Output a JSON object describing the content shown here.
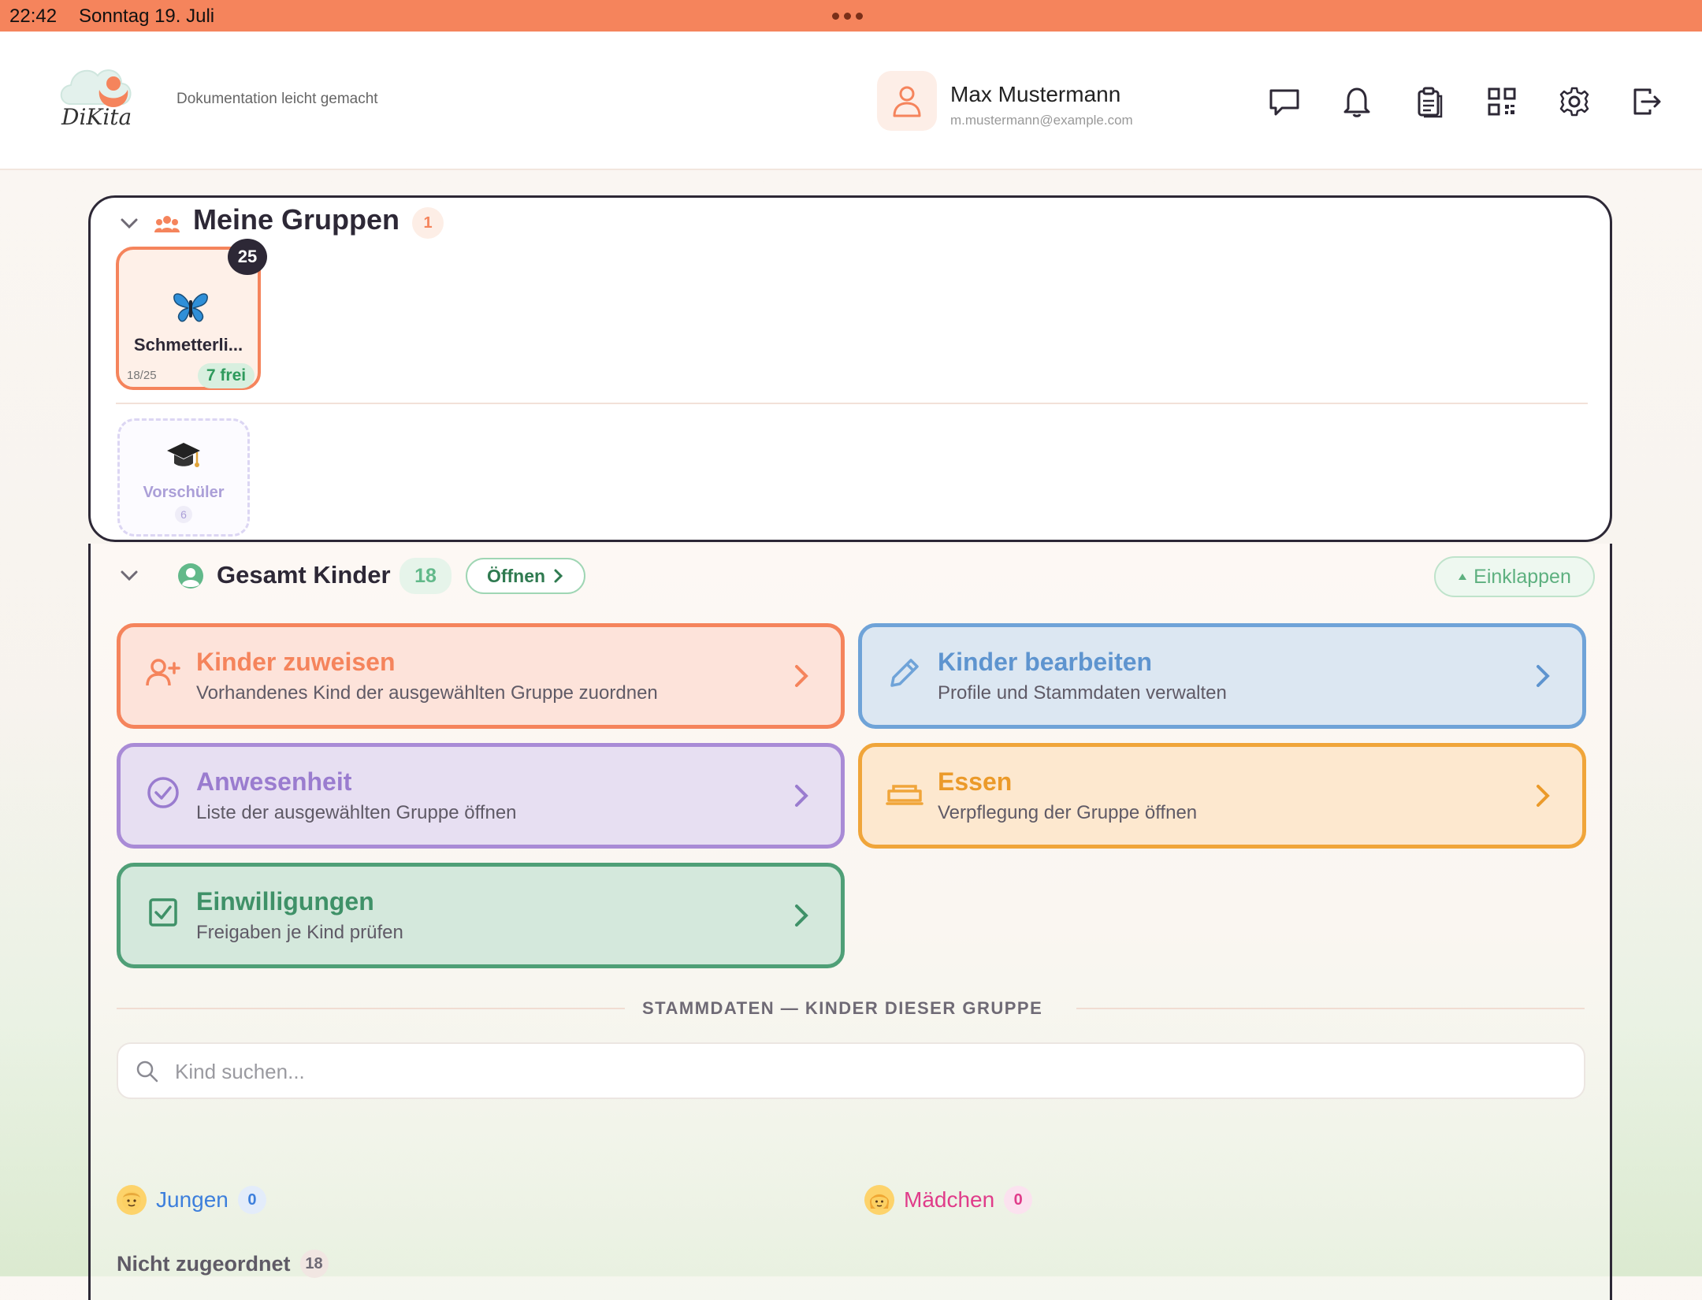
{
  "status_bar": {
    "time": "22:42",
    "date": "Sonntag 19. Juli"
  },
  "header": {
    "logo_text": "DiKita",
    "tagline": "Dokumentation leicht gemacht",
    "user": {
      "name": "Max Mustermann",
      "email": "m.mustermann@example.com"
    },
    "icons": [
      "chat-icon",
      "bell-icon",
      "clipboard-icon",
      "qr-code-icon",
      "gear-icon",
      "logout-icon"
    ]
  },
  "groups": {
    "title": "Meine Gruppen",
    "count": "1",
    "cards": [
      {
        "name": "Schmetterli...",
        "badge": "25",
        "ratio": "18/25",
        "free": "7 frei",
        "icon": "butterfly-icon"
      }
    ],
    "preschool": {
      "name": "Vorschüler",
      "count": "6",
      "icon": "graduation-cap-icon"
    }
  },
  "kinder": {
    "title": "Gesamt Kinder",
    "count": "18",
    "open_label": "Öffnen",
    "collapse_label": "Einklappen",
    "actions": [
      {
        "title": "Kinder zuweisen",
        "desc": "Vorhandenes Kind der ausgewählten Gruppe zuordnen",
        "color": "#f5845c",
        "bg": "#fde3da",
        "icon": "user-plus-icon"
      },
      {
        "title": "Kinder bearbeiten",
        "desc": "Profile und Stammdaten verwalten",
        "color": "#6fa3d8",
        "bg": "#dce7f2",
        "icon": "pencil-icon"
      },
      {
        "title": "Anwesenheit",
        "desc": "Liste der ausgewählten Gruppe öffnen",
        "color": "#a98bd6",
        "bg": "#e7dff2",
        "icon": "check-circle-icon"
      },
      {
        "title": "Essen",
        "desc": "Verpflegung der Gruppe öffnen",
        "color": "#f0a53a",
        "bg": "#fde8cf",
        "icon": "food-tray-icon"
      },
      {
        "title": "Einwilligungen",
        "desc": "Freigaben je Kind prüfen",
        "color": "#4f9f77",
        "bg": "#d4e8dc",
        "icon": "check-square-icon"
      }
    ],
    "stammdaten_label": "STAMMDATEN — KINDER DIESER GRUPPE",
    "search_placeholder": "Kind suchen...",
    "categories": {
      "boys": {
        "label": "Jungen",
        "count": "0"
      },
      "girls": {
        "label": "Mädchen",
        "count": "0"
      },
      "unassigned": {
        "label": "Nicht zugeordnet",
        "count": "18"
      }
    }
  }
}
